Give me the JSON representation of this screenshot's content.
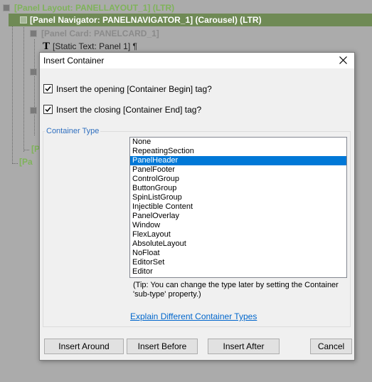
{
  "tree": {
    "panel_layout": "[Panel Layout: PANELLAYOUT_1] (LTR)",
    "panel_navigator": "[Panel Navigator: PANELNAVIGATOR_1] (Carousel) (LTR)",
    "panel_card": "[Panel Card: PANELCARD_1]",
    "static_text_icon": "T",
    "static_text": "[Static Text: Panel 1] ¶",
    "partial_1": "[P",
    "partial_2": "[Pa"
  },
  "dialog": {
    "title": "Insert Container",
    "close_glyph": "×",
    "insert_opening_label": "Insert the opening [Container Begin] tag?",
    "insert_opening_checked": true,
    "insert_closing_label": "Insert the closing [Container End] tag?",
    "insert_closing_checked": true,
    "group_label": "Container Type",
    "container_types": [
      "None",
      "RepeatingSection",
      "PanelHeader",
      "PanelFooter",
      "ControlGroup",
      "ButtonGroup",
      "SpinListGroup",
      "Injectible Content",
      "PanelOverlay",
      "Window",
      "FlexLayout",
      "AbsoluteLayout",
      "NoFloat",
      "EditorSet",
      "Editor"
    ],
    "selected_type": "PanelHeader",
    "tip": "(Tip: You can change the type later  by setting the Container 'sub-type' property.)",
    "explain_link": "Explain Different Container Types",
    "buttons": {
      "insert_around": "Insert Around",
      "insert_before": "Insert Before",
      "insert_after": "Insert After",
      "cancel": "Cancel"
    },
    "accent_color": "#0078d7",
    "link_color": "#0066cc",
    "group_label_color": "#2f6fbf"
  }
}
